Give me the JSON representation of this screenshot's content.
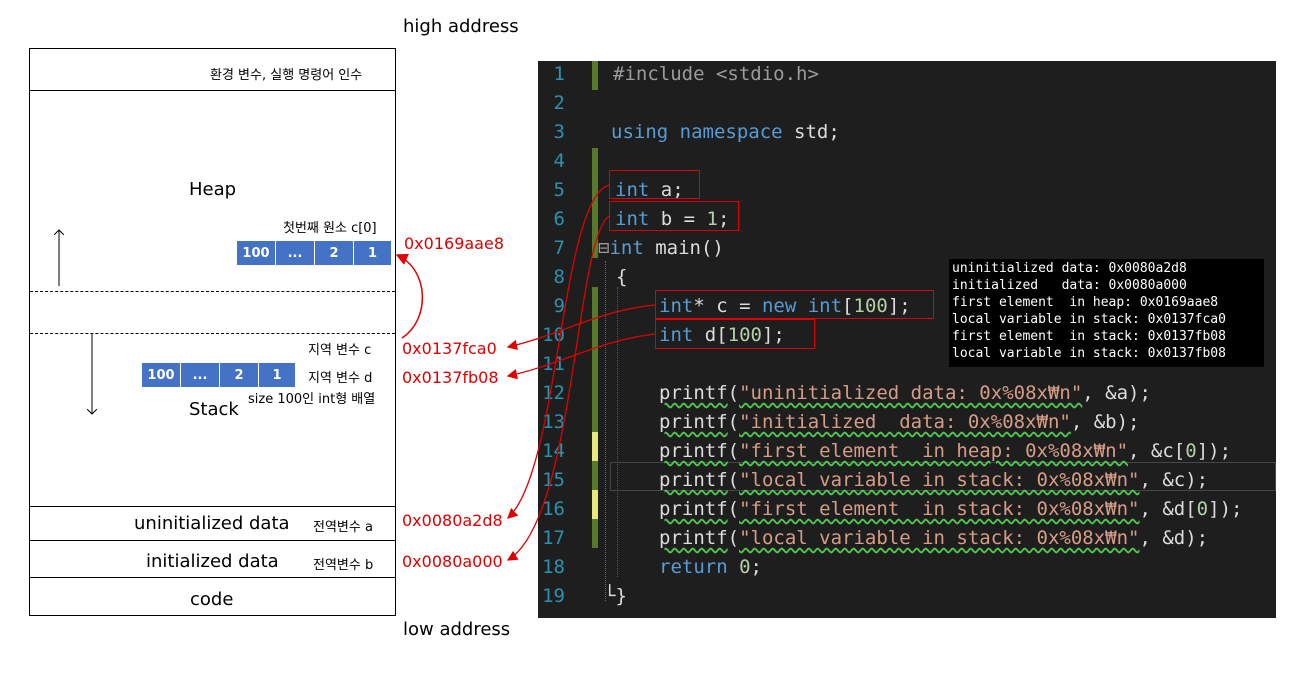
{
  "labels": {
    "high_address": "high address",
    "low_address": "low address"
  },
  "memory": {
    "env_section": "환경 변수, 실행 명령어 인수",
    "heap": "Heap",
    "stack": "Stack",
    "uninitialized": "uninitialized data",
    "initialized": "initialized data",
    "code": "code",
    "heap_first_elem": "첫번째 원소 c[0]",
    "local_c": "지역 변수 c",
    "local_d": "지역 변수 d",
    "array_desc": "size 100인 int형 배열",
    "global_a": "전역변수 a",
    "global_b": "전역변수 b",
    "heap_cells": [
      "100",
      "...",
      "2",
      "1"
    ],
    "stack_cells": [
      "100",
      "...",
      "2",
      "1"
    ]
  },
  "addresses": {
    "heap_c0": "0x0169aae8",
    "stack_c": "0x0137fca0",
    "stack_d": "0x0137fb08",
    "data_a": "0x0080a2d8",
    "data_b": "0x0080a000"
  },
  "editor": {
    "line_numbers": [
      "1",
      "2",
      "3",
      "4",
      "5",
      "6",
      "7",
      "8",
      "9",
      "10",
      "11",
      "12",
      "13",
      "14",
      "15",
      "16",
      "17",
      "18",
      "19"
    ]
  },
  "console_output": [
    "uninitialized data: 0x0080a2d8",
    "initialized   data: 0x0080a000",
    "first element  in heap: 0x0169aae8",
    "local variable in stack: 0x0137fca0",
    "first element  in stack: 0x0137fb08",
    "local variable in stack: 0x0137fb08"
  ],
  "colors": {
    "arrow_red": "#e00000",
    "cell_blue": "#4472c4",
    "editor_bg": "#1e1e1e"
  }
}
